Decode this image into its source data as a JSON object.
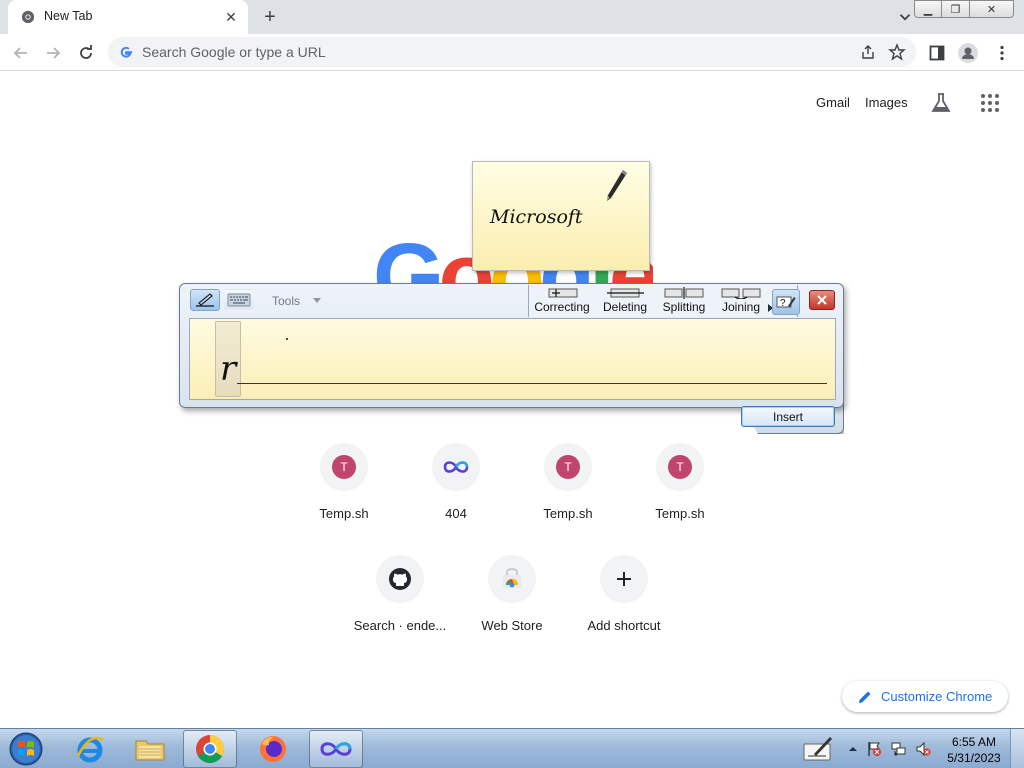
{
  "browser": {
    "tab": {
      "title": "New Tab"
    },
    "omnibox": {
      "placeholder": "Search Google or type a URL"
    }
  },
  "ntp": {
    "top_links": {
      "gmail": "Gmail",
      "images": "Images"
    },
    "logo_text": "Google",
    "shortcuts": [
      {
        "label": "Temp.sh",
        "icon": "T"
      },
      {
        "label": "404",
        "icon": "infinity-icon"
      },
      {
        "label": "Temp.sh",
        "icon": "T"
      },
      {
        "label": "Temp.sh",
        "icon": "T"
      },
      {
        "label": "Search · ende...",
        "icon": "github-icon"
      },
      {
        "label": "Web Store",
        "icon": "webstore-icon"
      },
      {
        "label": "Add shortcut",
        "icon": "plus-icon"
      }
    ],
    "customize_label": "Customize Chrome"
  },
  "ink_preview": {
    "text": "Microsoft"
  },
  "input_panel": {
    "tools_label": "Tools",
    "gestures": [
      "Correcting",
      "Deleting",
      "Splitting",
      "Joining"
    ],
    "written_char": "r",
    "insert_label": "Insert"
  },
  "taskbar": {
    "time": "6:55 AM",
    "date": "5/31/2023"
  },
  "colors": {
    "google_blue": "#4285f4",
    "google_red": "#ea4335",
    "google_yellow": "#fbbc05",
    "google_green": "#34a853",
    "link_blue": "#1a73e8",
    "avatar_pink": "#c0446b"
  }
}
